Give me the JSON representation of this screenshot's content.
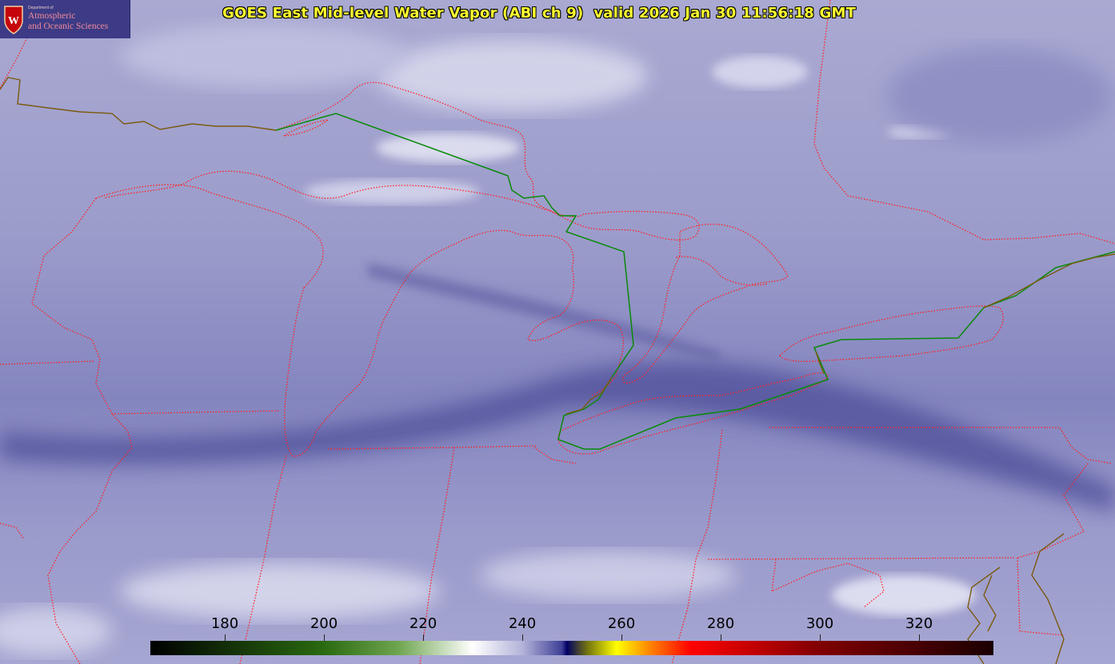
{
  "title": "GOES East Mid-level Water Vapor (ABI ch 9)  valid 2026 Jan 30 11:56:18 GMT",
  "logo": {
    "department_label": "Department of",
    "line1": "Atmospheric",
    "line2": "and Oceanic Sciences",
    "emblem": "W"
  },
  "colorbar": {
    "min": 165,
    "max": 335,
    "tick_labels": [
      "180",
      "200",
      "220",
      "240",
      "260",
      "280",
      "300",
      "320"
    ],
    "tick_values": [
      180,
      200,
      220,
      240,
      260,
      280,
      300,
      320
    ],
    "color_stops": [
      {
        "value": 165,
        "color": "#000000"
      },
      {
        "value": 200,
        "color": "#2a6a10"
      },
      {
        "value": 215,
        "color": "#6fa550"
      },
      {
        "value": 230,
        "color": "#ffffff"
      },
      {
        "value": 240,
        "color": "#b3b3d9"
      },
      {
        "value": 248,
        "color": "#3f3f96"
      },
      {
        "value": 249,
        "color": "#000066"
      },
      {
        "value": 253,
        "color": "#707010"
      },
      {
        "value": 259,
        "color": "#ffff00"
      },
      {
        "value": 266,
        "color": "#ff8000"
      },
      {
        "value": 274,
        "color": "#ff0000"
      },
      {
        "value": 300,
        "color": "#800000"
      },
      {
        "value": 335,
        "color": "#1a0000"
      }
    ]
  },
  "colors": {
    "state_borders": "#ff2020",
    "international_border": "#0a8a0a",
    "coastline": "#7a5a10",
    "title_text": "#ffff30"
  }
}
